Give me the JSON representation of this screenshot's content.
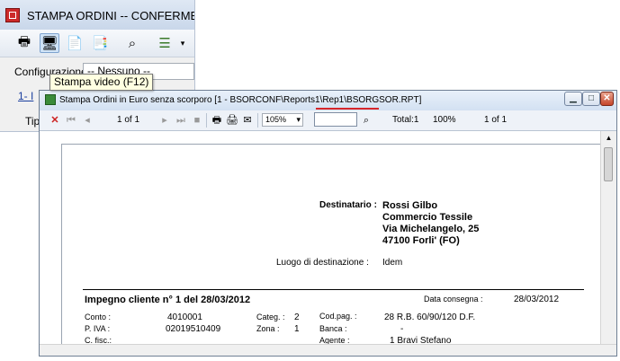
{
  "main_window": {
    "title": "STAMPA ORDINI -- CONFERME D'O",
    "config_label": "Configurazione",
    "config_value": "-- Nessuno --",
    "tab_label": "1- I",
    "tipo_label": "Tip",
    "tooltip": "Stampa video (F12)"
  },
  "report_window": {
    "title": "Stampa Ordini in Euro senza scorporo [1 - BSORCONF\\Reports1\\Rep1\\BSORGSOR.RPT]",
    "toolbar": {
      "page_display": "1 of 1",
      "zoom": "105%",
      "search_value": "",
      "total": "Total:1",
      "percent": "100%",
      "page_count": "1 of 1"
    }
  },
  "report": {
    "destinatario_label": "Destinatario :",
    "destinatario_lines": [
      "Rossi Gilbo",
      "Commercio Tessile",
      "Via Michelangelo, 25",
      "47100 Forli' (FO)"
    ],
    "luogo_label": "Luogo di destinazione :",
    "luogo_value": "Idem",
    "impegno": "Impegno cliente n° 1 del 28/03/2012",
    "data_consegna_label": "Data consegna :",
    "data_consegna_value": "28/03/2012",
    "conto_label": "Conto :",
    "conto_value": "4010001",
    "piva_label": "P. IVA :",
    "piva_value": "02019510409",
    "cfisc_label": "C. fisc.:",
    "categ_label": "Categ. :",
    "categ_value": "2",
    "zona_label": "Zona :",
    "zona_value": "1",
    "codpag_label": "Cod.pag. :",
    "codpag_value": "28  R.B. 60/90/120 D.F.",
    "banca_label": "Banca :",
    "banca_value": "-",
    "agente_label": "Agente :",
    "agente_value": "1  Bravi Stefano"
  },
  "icons": [
    "app-icon",
    "print-icon",
    "monitor-icon",
    "document-icon",
    "pdf-icon",
    "binoculars-icon",
    "list-icon",
    "close-x-icon",
    "first-page-icon",
    "prev-page-icon",
    "next-page-icon",
    "last-page-icon",
    "stop-icon",
    "printer-icon",
    "printer-setup-icon",
    "export-icon",
    "search-binoculars-icon"
  ],
  "colors": {
    "accent_red": "#d7262b",
    "title_bg": "#d3e1f2",
    "close_x": "#cc1f1f"
  }
}
